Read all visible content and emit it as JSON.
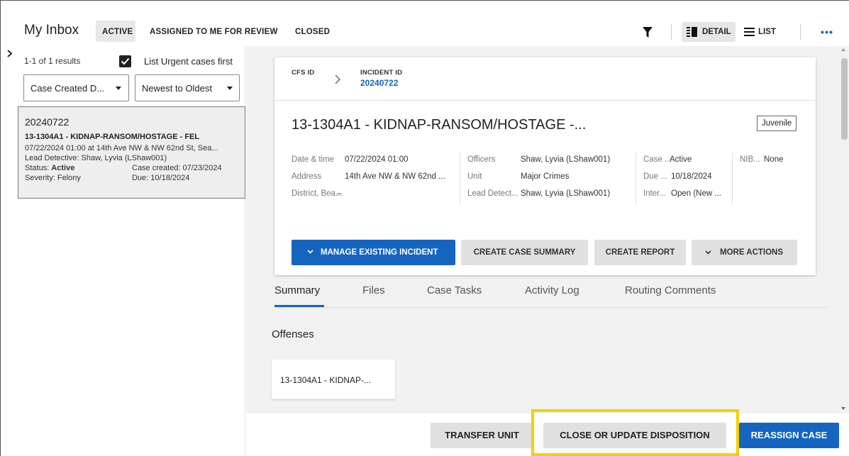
{
  "header": {
    "title": "My Inbox",
    "tabs": [
      {
        "label": "ACTIVE"
      },
      {
        "label": "ASSIGNED TO ME FOR REVIEW"
      },
      {
        "label": "CLOSED"
      }
    ],
    "view_detail_label": "DETAIL",
    "view_list_label": "LIST",
    "icons": [
      "filter-icon",
      "detail-view-icon",
      "list-view-icon",
      "more-horizontal-icon"
    ]
  },
  "left": {
    "results": "1-1 of 1 results",
    "urgent_first_label": "List Urgent cases first",
    "urgent_first_checked": true,
    "sort_field": "Case Created D...",
    "sort_order": "Newest to Oldest",
    "case_card": {
      "id": "20240722",
      "title": "13-1304A1 - KIDNAP-RANSOM/HOSTAGE - FEL",
      "when_where": "07/22/2024 01:00 at 14th Ave NW & NW 62nd St, Sea...",
      "lead_detective": "Lead Detective: Shaw, Lyvia (LShaw001)",
      "status_label": "Status: ",
      "status_value": "Active",
      "case_created": "Case created: 07/23/2024",
      "severity": "Severity: Felony",
      "due": "Due: 10/18/2024"
    }
  },
  "incident": {
    "cfs_label": "CFS ID",
    "incident_id_label": "INCIDENT ID",
    "incident_id": "20240722",
    "title": "13-1304A1 - KIDNAP-RANSOM/HOSTAGE -...",
    "badge": "Juvenile",
    "fields": {
      "datetime_label": "Date & time",
      "datetime_value": "07/22/2024 01:00",
      "address_label": "Address",
      "address_value": "14th Ave NW & NW 62nd ...",
      "district_label": "District, Bea...",
      "district_value": "–",
      "officers_label": "Officers",
      "officers_value": "Shaw, Lyvia (LShaw001)",
      "unit_label": "Unit",
      "unit_value": "Major Crimes",
      "lead_label": "Lead Detect...",
      "lead_value": "Shaw, Lyvia (LShaw001)",
      "case_status_label": "Case ...",
      "case_status_value": "Active",
      "due_label": "Due ...",
      "due_value": "10/18/2024",
      "inter_label": "Inter...",
      "inter_value": "Open (New ...",
      "nib_label": "NIB...",
      "nib_value": "None"
    },
    "actions": {
      "manage": "MANAGE EXISTING INCIDENT",
      "summary": "CREATE CASE SUMMARY",
      "report": "CREATE REPORT",
      "more": "MORE ACTIONS"
    }
  },
  "detail_tabs": [
    "Summary",
    "Files",
    "Case Tasks",
    "Activity Log",
    "Routing Comments"
  ],
  "offenses": {
    "heading": "Offenses",
    "items": [
      "13-1304A1 - KIDNAP-..."
    ]
  },
  "footer": {
    "transfer": "TRANSFER UNIT",
    "close_update": "CLOSE OR UPDATE DISPOSITION",
    "reassign": "REASSIGN CASE"
  },
  "colors": {
    "accent_blue": "#1565c0",
    "highlight_yellow": "#f5d000",
    "button_grey": "#e0e0e0"
  }
}
